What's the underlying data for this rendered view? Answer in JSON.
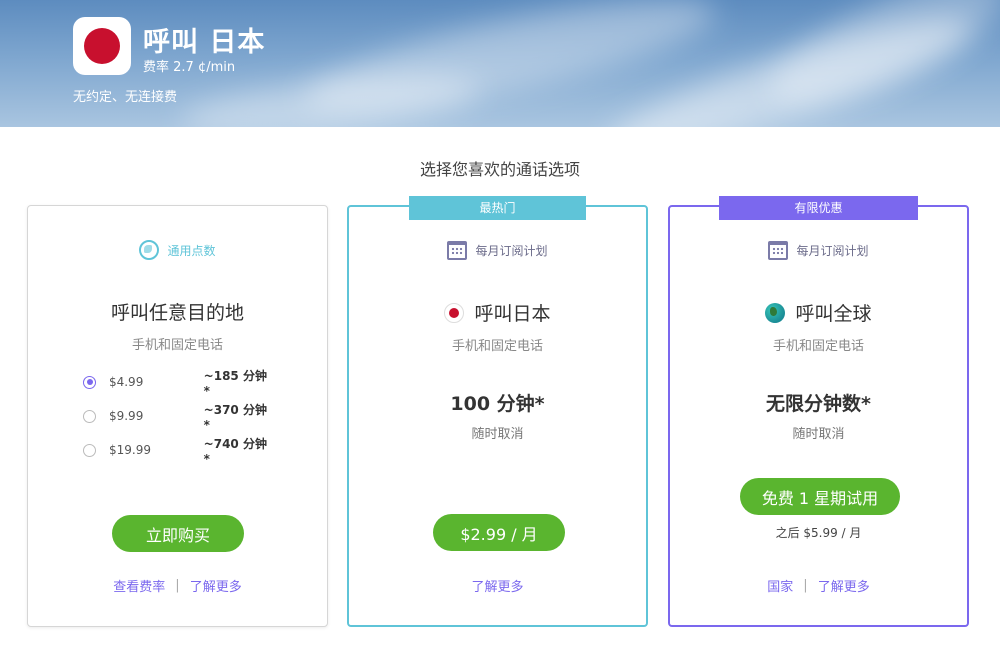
{
  "hero": {
    "title": "呼叫 日本",
    "rate": "费率 2.7  ¢/min",
    "subtitle": "无约定、无连接费",
    "flag_colors": {
      "sun": "#c8102e",
      "tile": "#ffffff"
    }
  },
  "heading": "选择您喜欢的通话选项",
  "accent_colors": {
    "green": "#5ab52f",
    "teal": "#5fc4d8",
    "purple": "#7b68ee"
  },
  "cards": [
    {
      "category": "通用点数",
      "category_icon": "globe-icon",
      "title": "呼叫任意目的地",
      "subtitle": "手机和固定电话",
      "options": [
        {
          "price": "$4.99",
          "minutes": "~185 分钟*",
          "selected": true
        },
        {
          "price": "$9.99",
          "minutes": "~370 分钟*",
          "selected": false
        },
        {
          "price": "$19.99",
          "minutes": "~740 分钟*",
          "selected": false
        }
      ],
      "button": "立即购买",
      "links": [
        "查看费率",
        "了解更多"
      ],
      "separator": "|"
    },
    {
      "ribbon": "最热门",
      "category": "每月订阅计划",
      "category_icon": "calendar-icon",
      "title": "呼叫日本",
      "title_icon": "japan-flag-icon",
      "subtitle": "手机和固定电话",
      "minutes": "100 分钟*",
      "cancel": "随时取消",
      "button": "$2.99 / 月",
      "links": [
        "了解更多"
      ]
    },
    {
      "ribbon": "有限优惠",
      "category": "每月订阅计划",
      "category_icon": "calendar-icon",
      "title": "呼叫全球",
      "title_icon": "globe-earth-icon",
      "subtitle": "手机和固定电话",
      "minutes": "无限分钟数*",
      "cancel": "随时取消",
      "button": "免费 1 星期试用",
      "after_text": "之后 $5.99 / 月",
      "links": [
        "国家",
        "了解更多"
      ],
      "separator": "|"
    }
  ]
}
